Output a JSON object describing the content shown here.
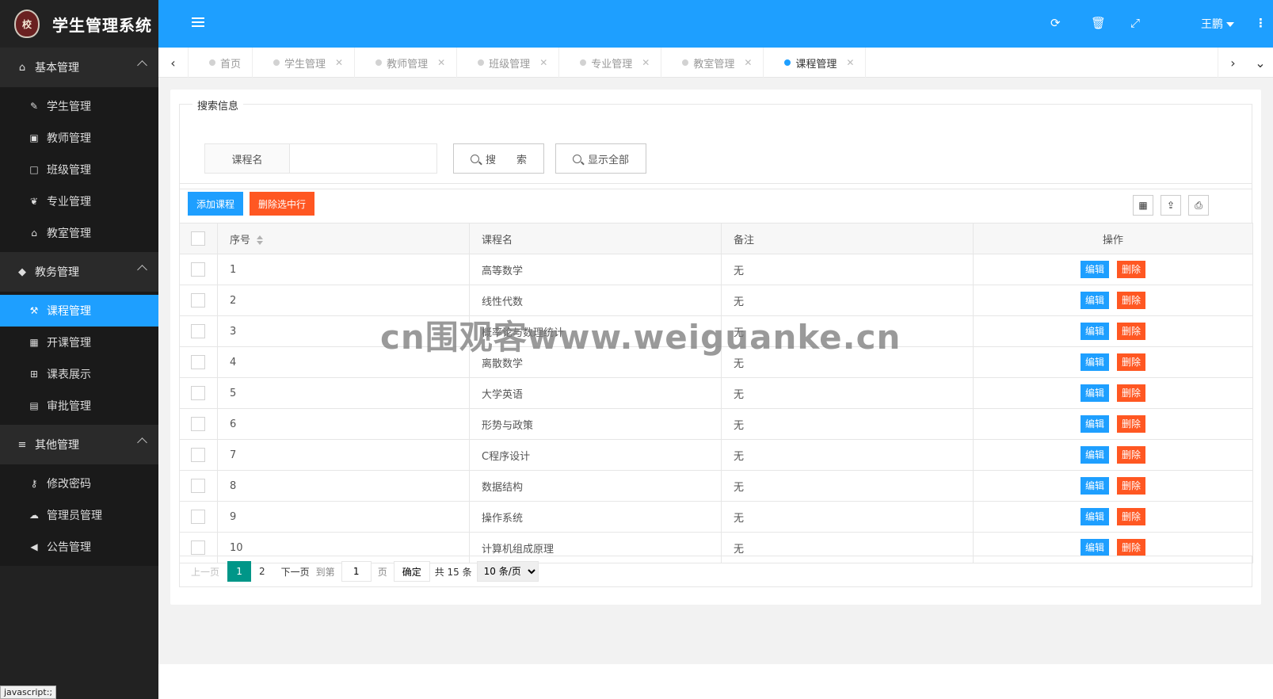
{
  "app": {
    "title": "学生管理系统",
    "logo_text": "校"
  },
  "sidebar": {
    "groups": [
      {
        "title": "基本管理",
        "icon": "home-icon",
        "items": [
          {
            "label": "学生管理",
            "icon": "pencil-icon"
          },
          {
            "label": "教师管理",
            "icon": "briefcase-icon"
          },
          {
            "label": "班级管理",
            "icon": "window-icon"
          },
          {
            "label": "专业管理",
            "icon": "leaf-icon"
          },
          {
            "label": "教室管理",
            "icon": "institution-icon"
          }
        ]
      },
      {
        "title": "教务管理",
        "icon": "graduation-cap-icon",
        "items": [
          {
            "label": "课程管理",
            "icon": "gavel-icon",
            "active": true
          },
          {
            "label": "开课管理",
            "icon": "calendar-icon"
          },
          {
            "label": "课表展示",
            "icon": "table-icon"
          },
          {
            "label": "审批管理",
            "icon": "book-icon"
          }
        ]
      },
      {
        "title": "其他管理",
        "icon": "bars-icon",
        "items": [
          {
            "label": "修改密码",
            "icon": "key-icon"
          },
          {
            "label": "管理员管理",
            "icon": "cloud-icon"
          },
          {
            "label": "公告管理",
            "icon": "bullhorn-icon"
          }
        ]
      }
    ]
  },
  "header": {
    "user_name": "王鹏",
    "icons": [
      "refresh-icon",
      "trash-icon",
      "fullscreen-icon",
      "more-icon"
    ]
  },
  "tabs": [
    {
      "label": "首页",
      "closable": false,
      "active": false
    },
    {
      "label": "学生管理",
      "closable": true,
      "active": false
    },
    {
      "label": "教师管理",
      "closable": true,
      "active": false
    },
    {
      "label": "班级管理",
      "closable": true,
      "active": false
    },
    {
      "label": "专业管理",
      "closable": true,
      "active": false
    },
    {
      "label": "教室管理",
      "closable": true,
      "active": false
    },
    {
      "label": "课程管理",
      "closable": true,
      "active": true
    }
  ],
  "search": {
    "legend": "搜索信息",
    "field_label": "课程名",
    "field_value": "",
    "search_button": "搜　　索",
    "show_all_button": "显示全部"
  },
  "toolbar": {
    "add_label": "添加课程",
    "delete_selected_label": "删除选中行"
  },
  "table": {
    "headers": {
      "index": "序号",
      "name": "课程名",
      "note": "备注",
      "ops": "操作"
    },
    "edit_label": "编辑",
    "delete_label": "删除",
    "rows": [
      {
        "index": "1",
        "name": "高等数学",
        "note": "无"
      },
      {
        "index": "2",
        "name": "线性代数",
        "note": "无"
      },
      {
        "index": "3",
        "name": "概率论与数理统计",
        "note": "无"
      },
      {
        "index": "4",
        "name": "离散数学",
        "note": "无"
      },
      {
        "index": "5",
        "name": "大学英语",
        "note": "无"
      },
      {
        "index": "6",
        "name": "形势与政策",
        "note": "无"
      },
      {
        "index": "7",
        "name": "C程序设计",
        "note": "无"
      },
      {
        "index": "8",
        "name": "数据结构",
        "note": "无"
      },
      {
        "index": "9",
        "name": "操作系统",
        "note": "无"
      },
      {
        "index": "10",
        "name": "计算机组成原理",
        "note": "无"
      }
    ]
  },
  "pager": {
    "prev": "上一页",
    "pages": [
      "1",
      "2"
    ],
    "current": "1",
    "next": "下一页",
    "goto_prefix": "到第",
    "goto_value": "1",
    "goto_suffix": "页",
    "confirm": "确定",
    "total": "共 15 条",
    "page_size": "10 条/页"
  },
  "watermark": "cn围观客www.weiguanke.cn",
  "status_tip": "javascript:;"
}
